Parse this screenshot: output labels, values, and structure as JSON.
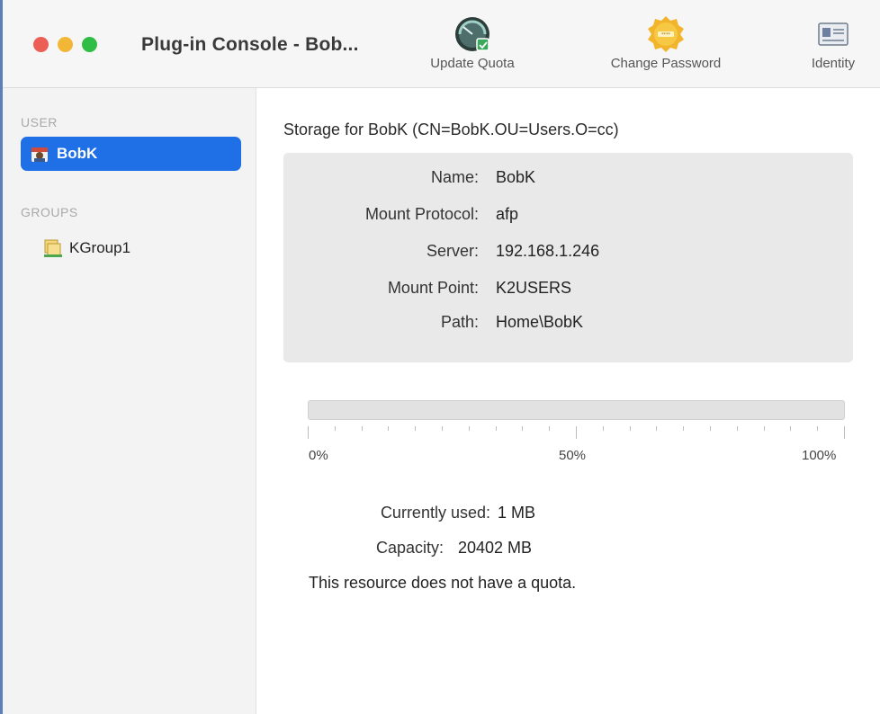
{
  "window": {
    "title": "Plug-in Console - Bob..."
  },
  "toolbar": {
    "update_quota": "Update Quota",
    "change_password": "Change Password",
    "identity": "Identity"
  },
  "sidebar": {
    "user_header": "USER",
    "user_item": "BobK",
    "groups_header": "GROUPS",
    "group_item": "KGroup1"
  },
  "storage": {
    "title": "Storage for BobK (CN=BobK.OU=Users.O=cc)",
    "fields": [
      {
        "label": "Name:",
        "value": "BobK"
      },
      {
        "label": "Mount Protocol:",
        "value": "afp"
      },
      {
        "label": "Server:",
        "value": "192.168.1.246"
      },
      {
        "label": "Mount Point:",
        "value": "K2USERS"
      },
      {
        "label": "Path:",
        "value": "Home\\BobK"
      }
    ]
  },
  "usage": {
    "fill_fraction": 0,
    "scale_labels": [
      "0%",
      "50%",
      "100%"
    ],
    "currently_used_label": "Currently used:",
    "currently_used_value": "1 MB",
    "capacity_label": "Capacity:",
    "capacity_value": "20402 MB",
    "note": "This resource does not have a quota."
  },
  "colors": {
    "selection": "#1f6fe6",
    "close": "#ec5f57",
    "minimize": "#f3b737",
    "zoom": "#2fbd46"
  }
}
